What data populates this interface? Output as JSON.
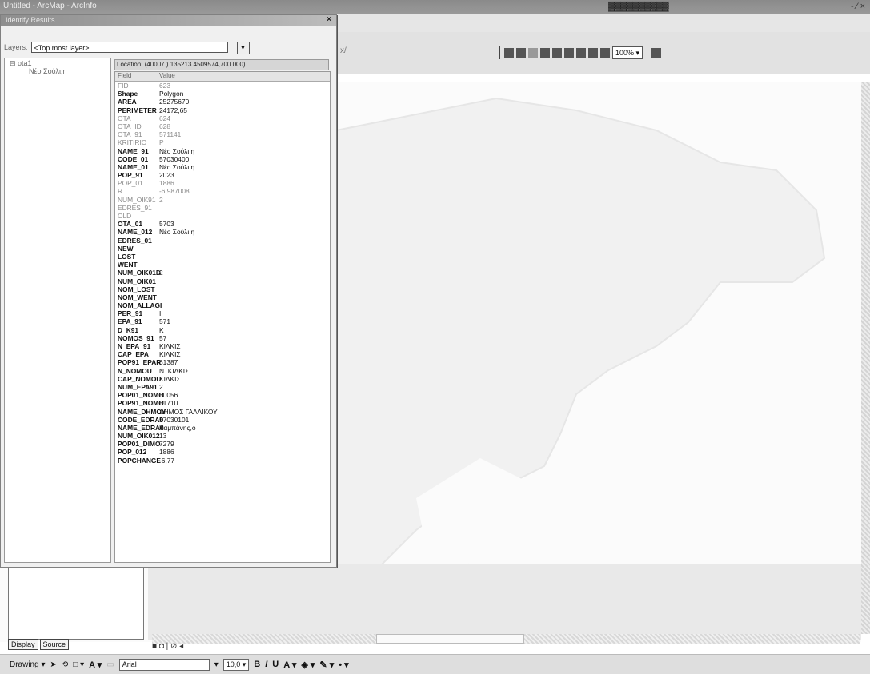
{
  "window": {
    "title": "Untitled - ArcMap - ArcInfo",
    "right_title": "▓▓▓▓▓▓▓▓▓▓",
    "window_controls": "- ⁄ ×"
  },
  "toolbar": {
    "fragment": "x/",
    "scale": "100%",
    "icons": [
      "zoom-in-icon",
      "zoom-out-icon",
      "pan-icon",
      "full-extent-icon",
      "fixed-zoom-in-icon",
      "fixed-zoom-out-icon",
      "back-extent-icon",
      "forward-extent-icon",
      "zoom-whole-page-icon",
      "change-layout-icon"
    ]
  },
  "identify": {
    "title": "Identify Results",
    "layers_label": "Layers:",
    "layers_value": "<Top most layer>",
    "tree_root": "⊟ ota1",
    "tree_child": "Νέο Σούλι,η",
    "location": "Location: (40007 ) 135213 4509574,700.000)",
    "columns": {
      "field": "Field",
      "value": "Value"
    },
    "rows": [
      {
        "field": "FID",
        "value": "623",
        "dim": true
      },
      {
        "field": "Shape",
        "value": "Polygon",
        "dim": false
      },
      {
        "field": "AREA",
        "value": "25275670",
        "dim": false
      },
      {
        "field": "PERIMETER",
        "value": "24172,65",
        "dim": false
      },
      {
        "field": "OTA_",
        "value": "624",
        "dim": true
      },
      {
        "field": "OTA_ID",
        "value": "628",
        "dim": true
      },
      {
        "field": "OTA_91",
        "value": "571141",
        "dim": true
      },
      {
        "field": "KRITIRIO",
        "value": "P",
        "dim": true
      },
      {
        "field": "NAME_91",
        "value": "Νέο Σούλι,η",
        "dim": false
      },
      {
        "field": "CODE_01",
        "value": "57030400",
        "dim": false
      },
      {
        "field": "NAME_01",
        "value": "Νέο Σούλι,η",
        "dim": false
      },
      {
        "field": "POP_91",
        "value": "2023",
        "dim": false
      },
      {
        "field": "POP_01",
        "value": "1886",
        "dim": true
      },
      {
        "field": "R",
        "value": "-6,987008",
        "dim": true
      },
      {
        "field": "NUM_OIK91",
        "value": "2",
        "dim": true
      },
      {
        "field": "EDRES_91",
        "value": "",
        "dim": true
      },
      {
        "field": "OLD",
        "value": "",
        "dim": true
      },
      {
        "field": "OTA_01",
        "value": "5703",
        "dim": false
      },
      {
        "field": "NAME_012",
        "value": "Νέο Σούλι,η",
        "dim": false
      },
      {
        "field": "EDRES_01",
        "value": "",
        "dim": false
      },
      {
        "field": "NEW",
        "value": "",
        "dim": false
      },
      {
        "field": "LOST",
        "value": "",
        "dim": false
      },
      {
        "field": "WENT",
        "value": "",
        "dim": false
      },
      {
        "field": "NUM_OIK01D",
        "value": "2",
        "dim": false
      },
      {
        "field": "NUM_OIK01",
        "value": "",
        "dim": false
      },
      {
        "field": "NOM_LOST",
        "value": "",
        "dim": false
      },
      {
        "field": "NOM_WENT",
        "value": "",
        "dim": false
      },
      {
        "field": "NOM_ALLAGI",
        "value": "",
        "dim": false
      },
      {
        "field": "PER_91",
        "value": "II",
        "dim": false
      },
      {
        "field": "EPA_91",
        "value": "571",
        "dim": false
      },
      {
        "field": "D_K91",
        "value": "K",
        "dim": false
      },
      {
        "field": "NOMOS_91",
        "value": "57",
        "dim": false
      },
      {
        "field": "N_EPA_91",
        "value": "ΚΙΛΚΙΣ",
        "dim": false
      },
      {
        "field": "CAP_EPA",
        "value": "ΚΙΛΚΙΣ",
        "dim": false
      },
      {
        "field": "POP91_EPAR",
        "value": "61387",
        "dim": false
      },
      {
        "field": "N_NOMOU",
        "value": "Ν. ΚΙΛΚΙΣ",
        "dim": false
      },
      {
        "field": "CAP_NOMOU",
        "value": "ΚΙΛΚΙΣ",
        "dim": false
      },
      {
        "field": "NUM_EPA91",
        "value": "2",
        "dim": false
      },
      {
        "field": "POP01_NOMO",
        "value": "80056",
        "dim": false
      },
      {
        "field": "POP91_NOMO",
        "value": "81710",
        "dim": false
      },
      {
        "field": "NAME_DHMOY",
        "value": "ΔΗΜΟΣ ΓΑΛΛΙΚΟΥ",
        "dim": false
      },
      {
        "field": "CODE_EDRA0",
        "value": "57030101",
        "dim": false
      },
      {
        "field": "NAME_EDRA0",
        "value": "Καμπάνης,ο",
        "dim": false
      },
      {
        "field": "NUM_OIK012",
        "value": "13",
        "dim": false
      },
      {
        "field": "POP01_DIMO",
        "value": "7279",
        "dim": false
      },
      {
        "field": "POP_012",
        "value": "1886",
        "dim": false
      },
      {
        "field": "POPCHANGE",
        "value": "-6,77",
        "dim": false
      }
    ]
  },
  "toc": {
    "tabs": [
      "Display",
      "Source"
    ]
  },
  "layout_nav": "■ ◘ | ⊘ ◂",
  "drawing": {
    "label": "Drawing ▾",
    "font": "Arial",
    "size": "10,0",
    "bold": "B",
    "italic": "I",
    "underline": "U"
  }
}
